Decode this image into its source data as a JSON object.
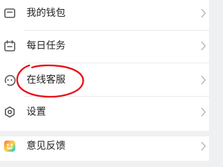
{
  "menu": {
    "items": [
      {
        "label": "我的钱包",
        "icon": "wallet-icon"
      },
      {
        "label": "每日任务",
        "icon": "calendar-icon"
      },
      {
        "label": "在线客服",
        "icon": "customer-service-icon"
      },
      {
        "label": "设置",
        "icon": "gear-icon"
      },
      {
        "label": "意见反馈",
        "icon": "feedback-icon"
      }
    ],
    "chevron_icon": "chevron-right-icon"
  },
  "colors": {
    "background": "#eef0f2",
    "row": "#ffffff",
    "text": "#232323",
    "icon": "#555555",
    "chevron": "#b8b8b8",
    "annotation": "#e8141c",
    "feedback_icon_gradient": [
      "#f5566b",
      "#ffb347",
      "#ffd24a",
      "#5fd3a0",
      "#48b3ff"
    ]
  }
}
